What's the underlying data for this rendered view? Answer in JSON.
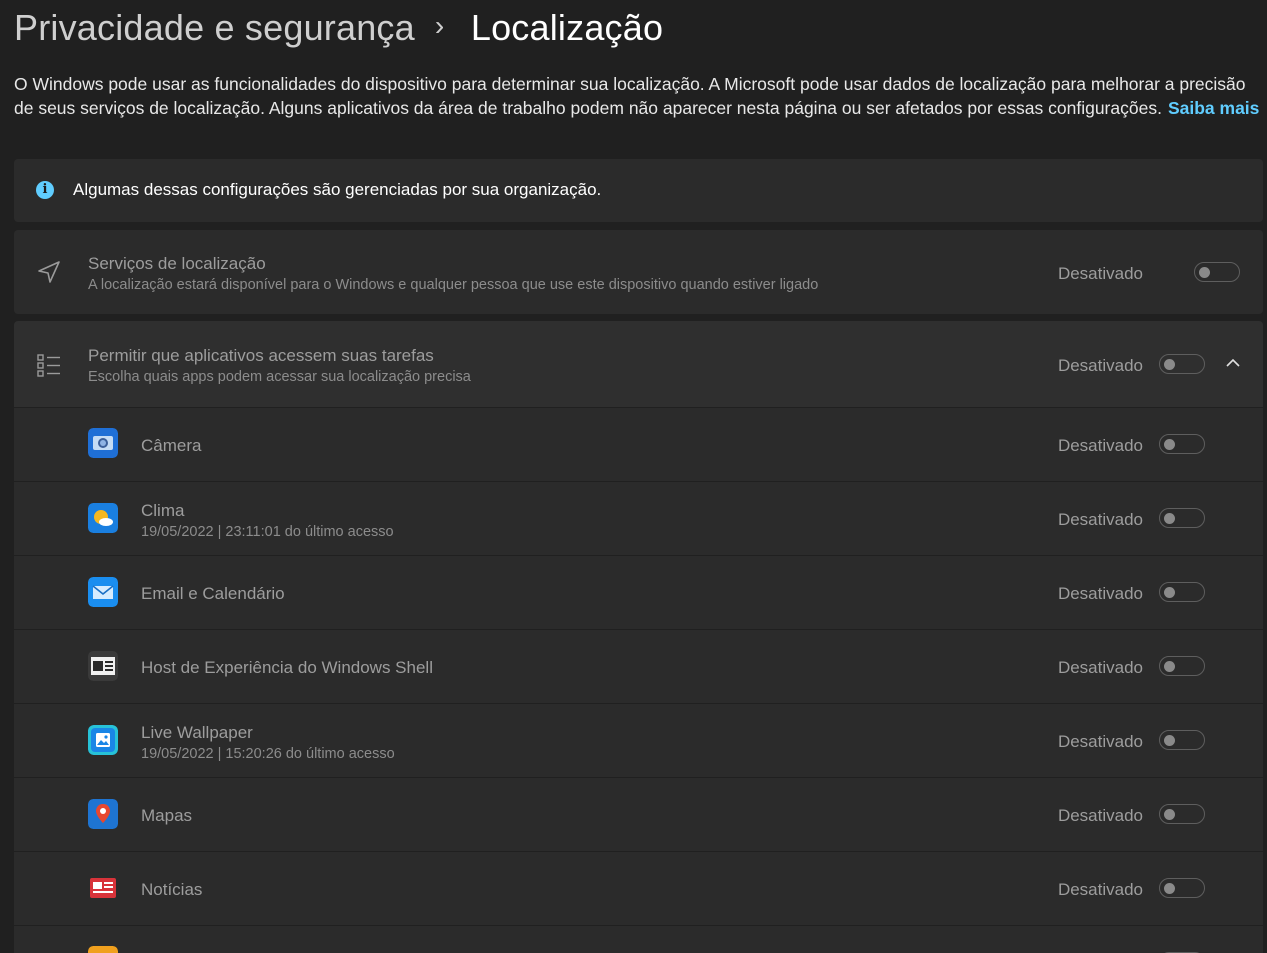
{
  "breadcrumb": {
    "parent": "Privacidade e segurança",
    "separator": "›",
    "current": "Localização"
  },
  "description": {
    "text": "O Windows pode usar as funcionalidades do dispositivo para determinar sua localização. A Microsoft pode usar dados de localização para melhorar a precisão de seus serviços de localização. Alguns aplicativos da área de trabalho podem não aparecer nesta página ou ser afetados por essas configurações.",
    "link": "Saiba mais"
  },
  "info_bar": {
    "icon": "info-icon",
    "text": "Algumas dessas configurações são gerenciadas por sua organização."
  },
  "location_services": {
    "icon": "navigation-arrow-icon",
    "title": "Serviços de localização",
    "subtitle": "A localização estará disponível para o Windows e qualquer pessoa que use este dispositivo quando estiver ligado",
    "state": "Desativado"
  },
  "app_access": {
    "icon": "list-icon",
    "title": "Permitir que aplicativos acessem suas tarefas",
    "subtitle": "Escolha quais apps podem acessar sua localização precisa",
    "state": "Desativado",
    "chevron": "chevron-up-icon"
  },
  "apps": [
    {
      "name": "Câmera",
      "sub": "",
      "state": "Desativado",
      "icon": "camera-icon",
      "color": "#1f6fd6"
    },
    {
      "name": "Clima",
      "sub": "19/05/2022  |  23:11:01 do último acesso",
      "state": "Desativado",
      "icon": "weather-icon",
      "color": "#1a7fe0"
    },
    {
      "name": "Email e Calendário",
      "sub": "",
      "state": "Desativado",
      "icon": "mail-icon",
      "color": "#1a8ef0"
    },
    {
      "name": "Host de Experiência do Windows Shell",
      "sub": "",
      "state": "Desativado",
      "icon": "shell-host-icon",
      "color": "#3a3a3a"
    },
    {
      "name": "Live Wallpaper",
      "sub": "19/05/2022  |  15:20:26 do último acesso",
      "state": "Desativado",
      "icon": "wallpaper-icon",
      "color": "#1a86e6"
    },
    {
      "name": "Mapas",
      "sub": "",
      "state": "Desativado",
      "icon": "maps-icon",
      "color": "#1e74d2"
    },
    {
      "name": "Notícias",
      "sub": "",
      "state": "Desativado",
      "icon": "news-icon",
      "color": "#d8333a"
    },
    {
      "name": "",
      "sub": "",
      "state": "",
      "icon": "app-icon",
      "color": "#f0a01e"
    }
  ],
  "colors": {
    "background": "#202020",
    "card": "#2b2b2b",
    "accent": "#60cdff"
  }
}
